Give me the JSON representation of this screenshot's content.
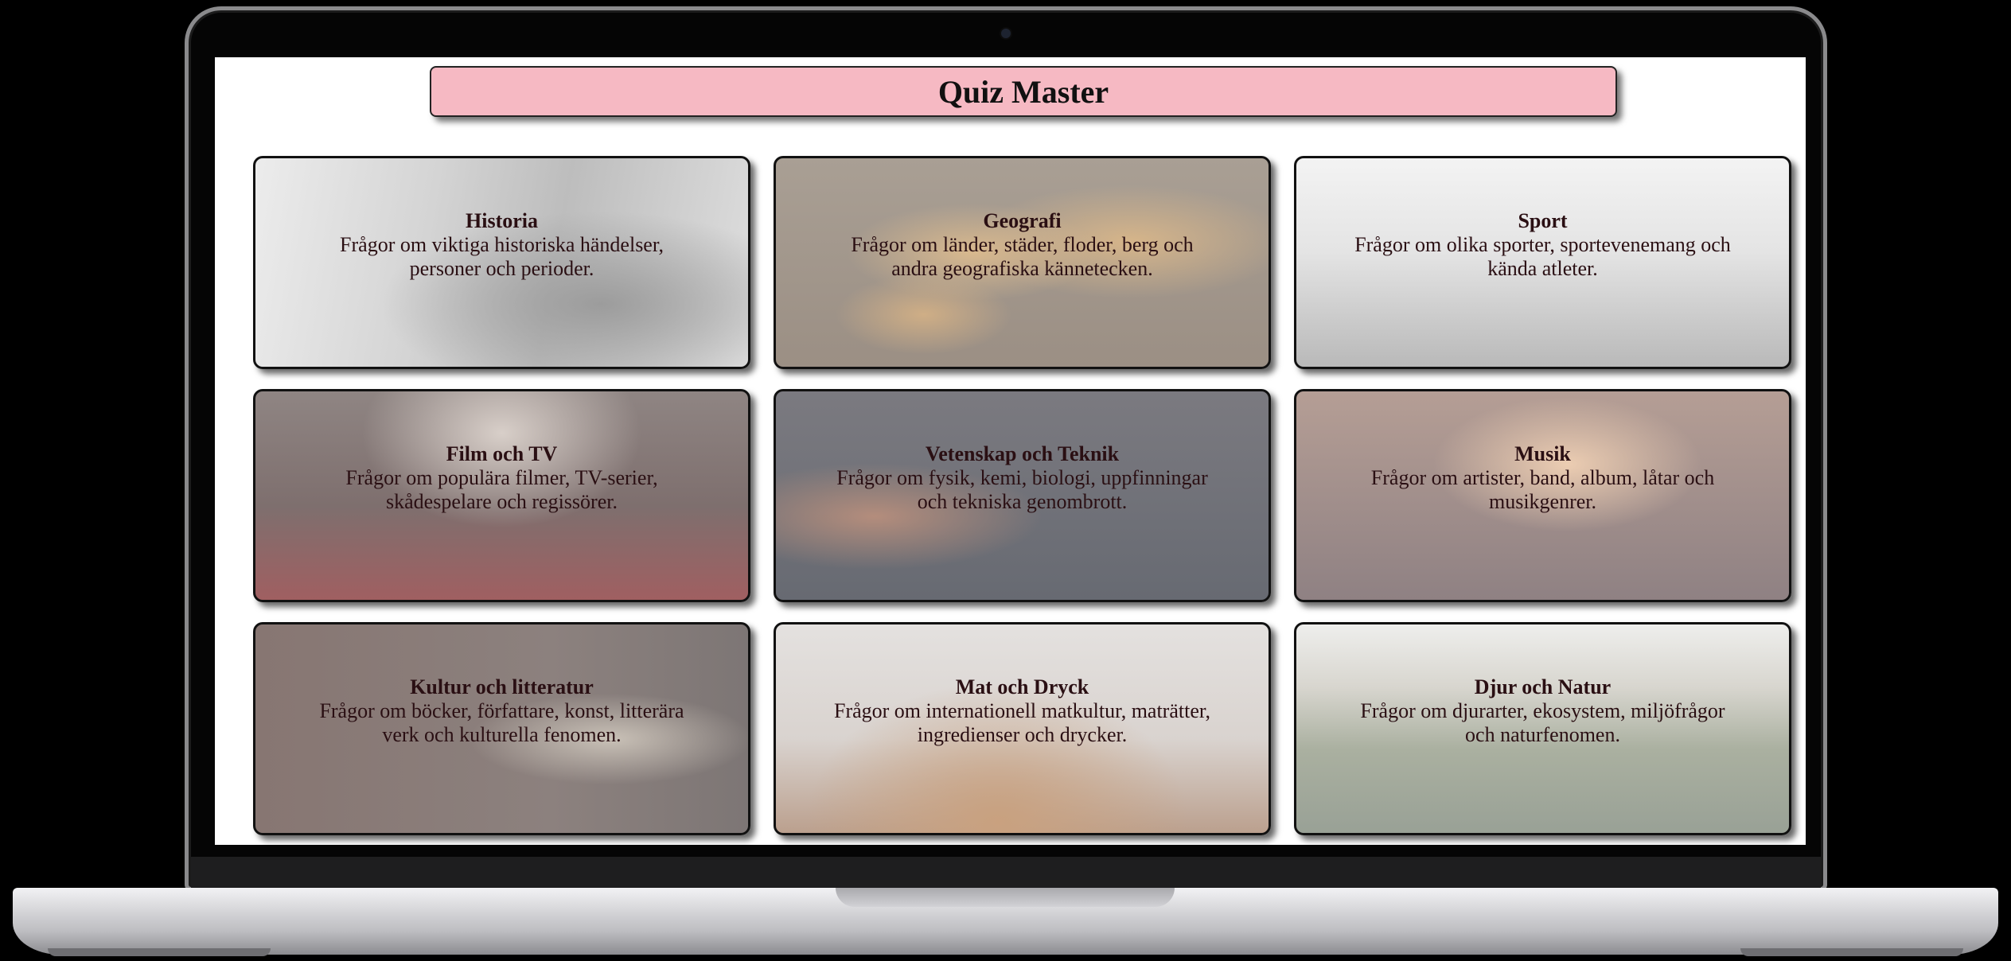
{
  "header": {
    "title": "Quiz Master"
  },
  "categories": [
    {
      "title": "Historia",
      "description": "Frågor om viktiga historiska händelser, personer och perioder."
    },
    {
      "title": "Geografi",
      "description": "Frågor om länder, städer, floder, berg och andra geografiska kännetecken."
    },
    {
      "title": "Sport",
      "description": "Frågor om olika sporter, sportevenemang och kända atleter."
    },
    {
      "title": "Film och TV",
      "description": "Frågor om populära filmer, TV-serier, skådespelare och regissörer."
    },
    {
      "title": "Vetenskap och Teknik",
      "description": "Frågor om fysik, kemi, biologi, uppfinningar och tekniska genombrott."
    },
    {
      "title": "Musik",
      "description": "Frågor om artister, band, album, låtar och musikgenrer."
    },
    {
      "title": "Kultur och litteratur",
      "description": "Frågor om böcker, författare, konst, litterära verk och kulturella fenomen."
    },
    {
      "title": "Mat och Dryck",
      "description": "Frågor om internationell matkultur, maträtter, ingredienser och drycker."
    },
    {
      "title": "Djur och Natur",
      "description": "Frågor om djurarter, ekosystem, miljöfrågor och naturfenomen."
    }
  ]
}
